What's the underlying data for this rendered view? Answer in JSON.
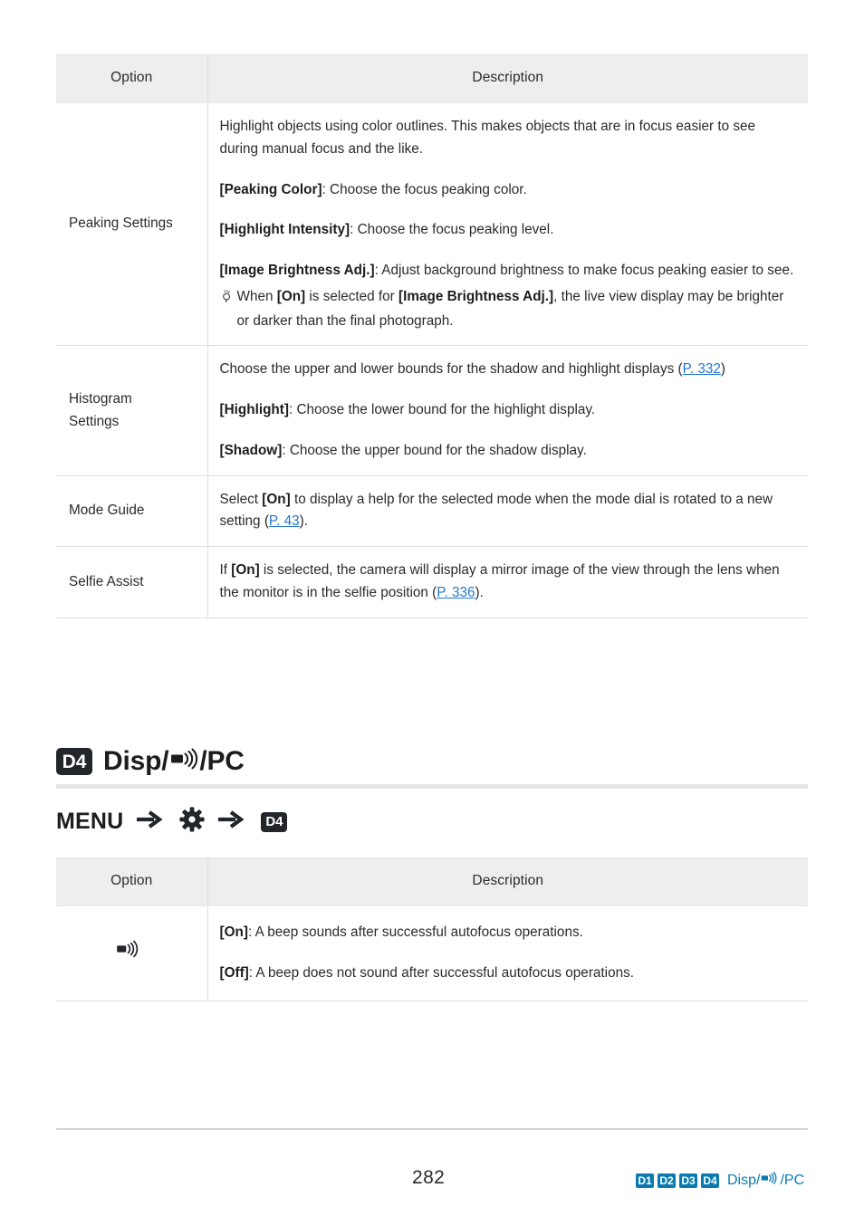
{
  "tables": [
    {
      "headers": {
        "option": "Option",
        "description": "Description"
      },
      "rows": [
        {
          "option": "Peaking Settings",
          "blocks": [
            {
              "kind": "plain",
              "text": "Highlight objects using color outlines. This makes objects that are in focus easier to see during manual focus and the like."
            },
            {
              "kind": "term",
              "term": "[Peaking Color]",
              "text": ": Choose the focus peaking color."
            },
            {
              "kind": "term",
              "term": "[Highlight Intensity]",
              "text": ": Choose the focus peaking level."
            },
            {
              "kind": "term",
              "term": "[Image Brightness Adj.]",
              "text": ": Adjust background brightness to make focus peaking easier to see."
            },
            {
              "kind": "tip",
              "pre": "When ",
              "b1": "[On]",
              "mid": " is selected for ",
              "b2": "[Image Brightness Adj.]",
              "post": ", the live view display may be brighter or darker than the final photograph."
            }
          ]
        },
        {
          "option": "Histogram Settings",
          "blocks": [
            {
              "kind": "link",
              "pre": "Choose the upper and lower bounds for the shadow and highlight displays (",
              "link": "P. 332",
              "post": ")"
            },
            {
              "kind": "term",
              "term": "[Highlight]",
              "text": ": Choose the lower bound for the highlight display."
            },
            {
              "kind": "term",
              "term": "[Shadow]",
              "text": ": Choose the upper bound for the shadow display."
            }
          ]
        },
        {
          "option": "Mode Guide",
          "blocks": [
            {
              "kind": "mixlink",
              "pre": "Select ",
              "b1": "[On]",
              "mid": " to display a help for the selected mode when the mode dial is rotated to a new setting (",
              "link": "P. 43",
              "post": ")."
            }
          ]
        },
        {
          "option": "Selfie Assist",
          "blocks": [
            {
              "kind": "mixlink",
              "pre": "If ",
              "b1": "[On]",
              "mid": " is selected, the camera will display a mirror image of the view through the lens when the monitor is in the selfie position (",
              "link": "P. 336",
              "post": ")."
            }
          ]
        }
      ]
    },
    {
      "headers": {
        "option": "Option",
        "description": "Description"
      },
      "rows": [
        {
          "option_icon": "speaker-beep-icon",
          "blocks": [
            {
              "kind": "term",
              "term": "[On]",
              "text": ": A beep sounds after successful autofocus operations."
            },
            {
              "kind": "term",
              "term": "[Off]",
              "text": ": A beep does not sound after successful autofocus operations."
            }
          ]
        }
      ]
    }
  ],
  "section": {
    "badge": "D4",
    "title_pre": "Disp/",
    "title_icon": "speaker-beep-icon",
    "title_post": "/PC"
  },
  "menu_path": {
    "menu_label": "MENU",
    "arrow_icon": "arrow-right-icon",
    "gear_icon": "gear-icon",
    "badge": "D4"
  },
  "footer": {
    "page_number": "282",
    "badges": [
      "D1",
      "D2",
      "D3",
      "D4"
    ],
    "label_pre": "Disp/",
    "label_icon": "speaker-beep-icon",
    "label_post": "/PC"
  },
  "colors": {
    "link": "#2277cc",
    "footer_accent": "#0b7ab0",
    "badge_dark": "#22262b",
    "header_bg": "#eeeeee",
    "rule": "#dfdfe1"
  }
}
